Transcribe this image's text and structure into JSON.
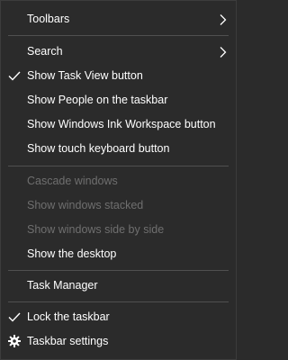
{
  "menu": {
    "toolbars": "Toolbars",
    "search": "Search",
    "show_task_view": "Show Task View button",
    "show_people": "Show People on the taskbar",
    "show_ink": "Show Windows Ink Workspace button",
    "show_touch_keyboard": "Show touch keyboard button",
    "cascade": "Cascade windows",
    "stacked": "Show windows stacked",
    "side_by_side": "Show windows side by side",
    "show_desktop": "Show the desktop",
    "task_manager": "Task Manager",
    "lock_taskbar": "Lock the taskbar",
    "taskbar_settings": "Taskbar settings"
  },
  "colors": {
    "background": "#2b2b2b",
    "text": "#ffffff",
    "disabled_text": "#6f6f6f",
    "separator": "#505050"
  },
  "icons": {
    "submenu": "chevron-right-icon",
    "checked": "checkmark-icon",
    "settings": "gear-icon"
  }
}
